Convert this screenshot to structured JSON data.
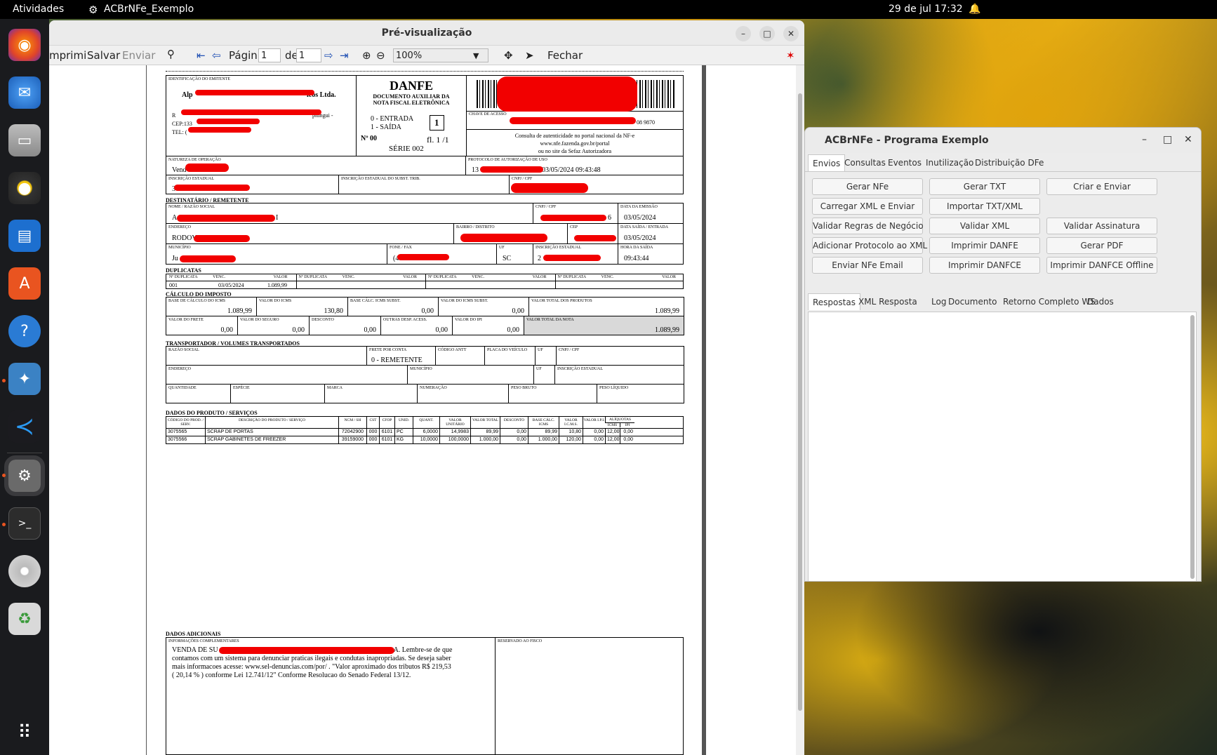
{
  "topbar": {
    "activities": "Atividades",
    "app": "ACBrNFe_Exemplo",
    "clock": "29 de jul  17:32"
  },
  "preview": {
    "title": "Pré-visualização",
    "toolbar": {
      "print": "mprimi",
      "save": "Salvar",
      "send": "Enviar",
      "page_label": "Págin",
      "page": "1",
      "of": "de",
      "pages": "1",
      "zoom": "100%",
      "close": "Fechar"
    }
  },
  "danfe": {
    "emit_label": "IDENTIFICAÇÃO DO EMITENTE",
    "emit_name_a": "Alp",
    "emit_name_b": "icos Ltda.",
    "emit_addr_a": "R",
    "emit_addr_b": "pitingui -",
    "emit_cep": "CEP:133",
    "emit_tel": "TEL: (",
    "title": "DANFE",
    "subtitle": "DOCUMENTO AUXILIAR DA NOTA FISCAL ELETRÔNICA",
    "entrada": "0 - ENTRADA",
    "saida": "1 - SAÍDA",
    "tipo": "1",
    "numero": "Nº 00",
    "folha": "fl. 1 /1",
    "serie": "SÉRIE 002",
    "chave_label": "CHAVE DE ACESSO",
    "chave_tail": "08 9870",
    "consulta1": "Consulta de autenticidade no portal nacional da NF-e",
    "consulta2": "www.nfe.fazenda.gov.br/portal",
    "consulta3": "ou no site da Sefaz Autorizadora",
    "natureza_label": "NATUREZA DE OPERAÇÃO",
    "natureza": "Vend",
    "protocolo_label": "PROTOCOLO DE AUTORIZAÇÃO DE USO",
    "protocolo_a": "13",
    "protocolo_b": "03/05/2024 09:43:48",
    "ie_label": "INSCRIÇÃO ESTADUAL",
    "ie": "3",
    "iest_label": "INSCRIÇÃO ESTADUAL DO SUBST. TRIB.",
    "cnpj_label": "CNPJ / CPF",
    "dest_title": "DESTINATÁRIO / REMETENTE",
    "nome_label": "NOME / RAZÃO SOCIAL",
    "nome_a": "A",
    "nome_b": "I",
    "dest_cnpj_label": "CNPJ / CPF",
    "dest_cnpj_tail": "6",
    "emissao_label": "DATA DA EMISSÃO",
    "emissao": "03/05/2024",
    "endereco_label": "ENDEREÇO",
    "endereco": "RODOVIA",
    "bairro_label": "BAIRRO / DISTRITO",
    "cep_label": "CEP",
    "saida_label": "DATA SAÍDA / ENTRADA",
    "saida_data": "03/05/2024",
    "municipio_label": "MUNICÍPIO",
    "municipio": "Ju",
    "fone_label": "FONE / FAX",
    "fone": "(4",
    "uf_label": "UF",
    "uf": "SC",
    "dest_ie_label": "INSCRIÇÃO ESTADUAL",
    "dest_ie": "2",
    "hora_label": "HORA DA SAÍDA",
    "hora": "09:43:44",
    "dup_title": "DUPLICATAS",
    "dup_headers": [
      "Nº DUPLICATA",
      "VENC.",
      "VALOR"
    ],
    "dup_row": [
      "001",
      "03/05/2024",
      "1.089,99"
    ],
    "imposto_title": "CÁLCULO DO IMPOSTO",
    "imp_r1": [
      {
        "l": "BASE DE CÁLCULO DO ICMS",
        "v": "1.089,99"
      },
      {
        "l": "VALOR DO ICMS",
        "v": "130,80"
      },
      {
        "l": "BASE CÁLC. ICMS SUBST.",
        "v": "0,00"
      },
      {
        "l": "VALOR DO ICMS SUBST.",
        "v": "0,00"
      },
      {
        "l": "VALOR TOTAL DOS PRODUTOS",
        "v": "1.089,99"
      }
    ],
    "imp_r2": [
      {
        "l": "VALOR DO FRETE",
        "v": "0,00"
      },
      {
        "l": "VALOR DO SEGURO",
        "v": "0,00"
      },
      {
        "l": "DESCONTO",
        "v": "0,00"
      },
      {
        "l": "OUTRAS DESP. ACESS.",
        "v": "0,00"
      },
      {
        "l": "VALOR DO IPI",
        "v": "0,00"
      },
      {
        "l": "VALOR TOTAL DA NOTA",
        "v": "1.089,99"
      }
    ],
    "transp_title": "TRANSPORTADOR / VOLUMES TRANSPORTADOS",
    "tr_r1": [
      "RAZÃO SOCIAL",
      "FRETE POR CONTA",
      "CÓDIGO ANTT",
      "PLACA DO VEÍCULO",
      "UF",
      "CNPJ / CPF"
    ],
    "frete": "0 - REMETENTE",
    "tr_r2": [
      "ENDEREÇO",
      "MUNICÍPIO",
      "UF",
      "INSCRIÇÃO ESTADUAL"
    ],
    "tr_r3": [
      "QUANTIDADE",
      "ESPÉCIE",
      "MARCA",
      "NUMERAÇÃO",
      "PESO BRUTO",
      "PESO LÍQUIDO"
    ],
    "prod_title": "DADOS DO PRODUTO / SERVIÇOS",
    "prod_headers": [
      "CÓDIGO DO PROD. / SERV.",
      "DESCRIÇÃO DO PRODUTO / SERVIÇO",
      "NCM / SH",
      "CST",
      "CFOP",
      "UNID.",
      "QUANT.",
      "VALOR UNITÁRIO",
      "VALOR TOTAL",
      "DESCONTO",
      "BASE CÁLC. ICMS",
      "VALOR I.C.M.S.",
      "VALOR I.P.I.",
      "ALÍQUOTAS"
    ],
    "aliq_sub": [
      "ICMS",
      "IPI"
    ],
    "prod_rows": [
      [
        "3075565",
        "SCRAP DE PORTAS",
        "72042900",
        "000",
        "6101",
        "PC",
        "6,0000",
        "14,9983",
        "89,99",
        "0,00",
        "89,99",
        "10,80",
        "0,00",
        "12,00",
        "0,00"
      ],
      [
        "3075566",
        "SCRAP GABINETES DE FREEZER",
        "39159000",
        "000",
        "6101",
        "KG",
        "10,0000",
        "100,0000",
        "1.000,00",
        "0,00",
        "1.000,00",
        "120,00",
        "0,00",
        "12,00",
        "0,00"
      ]
    ],
    "adic_title": "DADOS ADICIONAIS",
    "inf_label": "INFORMAÇÕES COMPLEMENTARES",
    "inf_l1a": "VENDA DE SU",
    "inf_l1b": "A. Lembre-se de que",
    "inf_l2": "contamos com um sistema para denunciar praticas ilegais e condutas inapropriadas. Se deseja saber",
    "inf_l3": "mais informacoes acesse: www.sel-denuncias.com/por/ . \"Valor aproximado dos tributos R$ 219,53",
    "inf_l4": "( 20,14 % ) conforme Lei 12.741/12\" Conforme Resolucao do Senado Federal 13/12.",
    "fisco_label": "RESERVADO AO FISCO"
  },
  "acbr": {
    "title": "ACBrNFe - Programa Exemplo",
    "tabs": [
      "Envios",
      "Consultas",
      "Eventos",
      "Inutilização",
      "Distribuição DFe"
    ],
    "buttons": [
      [
        "Gerar NFe",
        "Gerar TXT",
        "Criar e Enviar"
      ],
      [
        "Carregar XML e Enviar",
        "Importar TXT/XML",
        ""
      ],
      [
        "Validar Regras de Negócio",
        "Validar XML",
        "Validar Assinatura"
      ],
      [
        "Adicionar Protocolo ao XML",
        "Imprimir DANFE",
        "Gerar PDF"
      ],
      [
        "Enviar NFe Email",
        "Imprimir DANFCE",
        "Imprimir DANFCE Offline"
      ]
    ],
    "resp_tabs": [
      "Respostas",
      "XML Resposta",
      "Log",
      "Documento",
      "Retorno Completo WS",
      "Dados"
    ]
  }
}
